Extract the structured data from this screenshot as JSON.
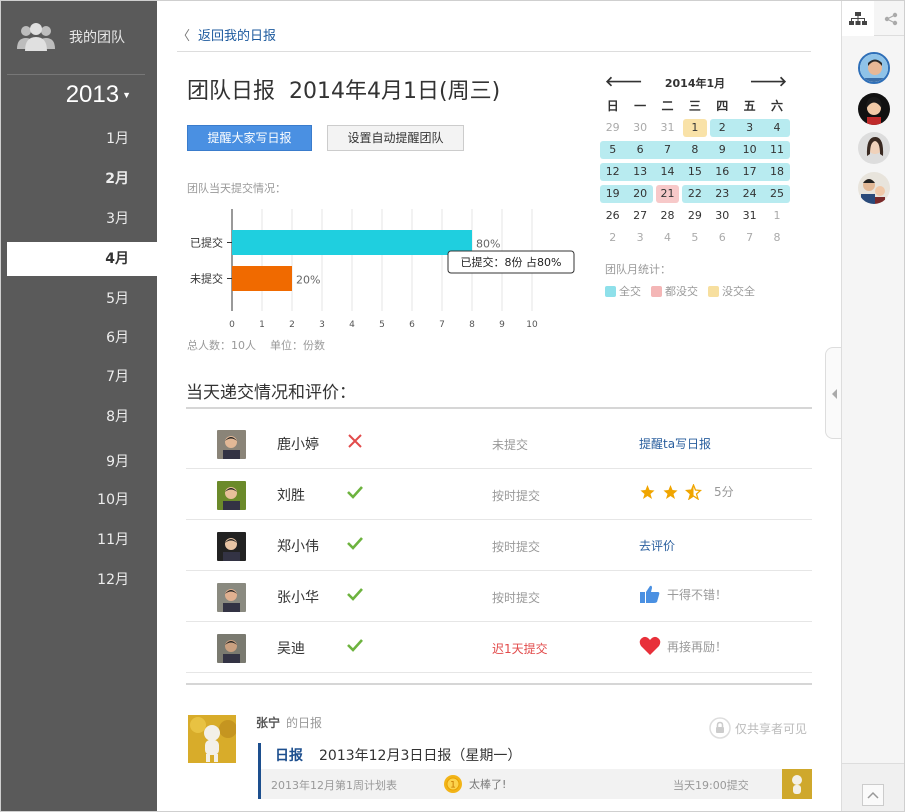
{
  "sidebar": {
    "team_label": "我的团队",
    "year": "2013",
    "months": [
      "1月",
      "2月",
      "3月",
      "4月",
      "5月",
      "6月",
      "7月",
      "8月",
      "9月",
      "10月",
      "11月",
      "12月"
    ],
    "active_month": "4月",
    "bold_months": [
      "2月",
      "4月"
    ]
  },
  "header": {
    "back_label": "返回我的日报",
    "title_prefix": "团队日报",
    "title_date": "2014年4月1日(周三)"
  },
  "buttons": {
    "remind_all": "提醒大家写日报",
    "auto_remind": "设置自动提醒团队"
  },
  "submission_chart": {
    "subtitle": "团队当天提交情况：",
    "tooltip": "已提交：8份 占80%",
    "footer_total": "总人数：10人",
    "footer_unit": "单位：份数"
  },
  "chart_data": {
    "type": "bar",
    "orientation": "horizontal",
    "categories": [
      "已提交",
      "未提交"
    ],
    "values": [
      8,
      2
    ],
    "data_labels": [
      "80%",
      "20%"
    ],
    "colors": [
      "#1fcfdf",
      "#f06a00"
    ],
    "xlim": [
      0,
      10
    ],
    "xticks": [
      0,
      1,
      2,
      3,
      4,
      5,
      6,
      7,
      8,
      9,
      10
    ],
    "grid": true
  },
  "section": {
    "title": "当天递交情况和评价："
  },
  "members": [
    {
      "name": "鹿小婷",
      "submitted": false,
      "status": "未提交",
      "status_color": "gray",
      "action": "提醒ta写日报",
      "action_type": "link"
    },
    {
      "name": "刘胜",
      "submitted": true,
      "status": "按时提交",
      "status_color": "gray",
      "action": "5分",
      "action_type": "stars",
      "stars": 2.5
    },
    {
      "name": "郑小伟",
      "submitted": true,
      "status": "按时提交",
      "status_color": "gray",
      "action": "去评价",
      "action_type": "link"
    },
    {
      "name": "张小华",
      "submitted": true,
      "status": "按时提交",
      "status_color": "gray",
      "action": "干得不错！",
      "action_type": "thumb"
    },
    {
      "name": "吴迪",
      "submitted": true,
      "status": "迟1天提交",
      "status_color": "red",
      "action": "再接再励！",
      "action_type": "heart"
    }
  ],
  "post": {
    "author": "张宁",
    "author_suffix": "的日报",
    "privacy": "仅共享者可见",
    "report_label": "日报",
    "report_title": "2013年12月3日日报（星期一）",
    "plan": "2013年12月第1周计划表",
    "badge_text": "太棒了!",
    "submit_time": "当天19:00提交"
  },
  "calendar": {
    "month_label": "2014年1月",
    "prev": "🡐",
    "next": "🡒",
    "weekdays": [
      "日",
      "一",
      "二",
      "三",
      "四",
      "五",
      "六"
    ],
    "weeks": [
      [
        {
          "d": "29",
          "o": 1
        },
        {
          "d": "30",
          "o": 1
        },
        {
          "d": "31",
          "o": 1
        },
        {
          "d": "1",
          "s": "y"
        },
        {
          "d": "2",
          "s": "c"
        },
        {
          "d": "3",
          "s": "c"
        },
        {
          "d": "4",
          "s": "c"
        }
      ],
      [
        {
          "d": "5",
          "s": "c"
        },
        {
          "d": "6",
          "s": "c"
        },
        {
          "d": "7",
          "s": "c"
        },
        {
          "d": "8",
          "s": "c"
        },
        {
          "d": "9",
          "s": "c"
        },
        {
          "d": "10",
          "s": "c"
        },
        {
          "d": "11",
          "s": "c"
        }
      ],
      [
        {
          "d": "12",
          "s": "c"
        },
        {
          "d": "13",
          "s": "c"
        },
        {
          "d": "14",
          "s": "c"
        },
        {
          "d": "15",
          "s": "c"
        },
        {
          "d": "16",
          "s": "c"
        },
        {
          "d": "17",
          "s": "c"
        },
        {
          "d": "18",
          "s": "c"
        }
      ],
      [
        {
          "d": "19",
          "s": "c"
        },
        {
          "d": "20",
          "s": "c"
        },
        {
          "d": "21",
          "s": "p"
        },
        {
          "d": "22",
          "s": "c"
        },
        {
          "d": "23",
          "s": "c"
        },
        {
          "d": "24",
          "s": "c"
        },
        {
          "d": "25",
          "s": "c"
        }
      ],
      [
        {
          "d": "26"
        },
        {
          "d": "27"
        },
        {
          "d": "28"
        },
        {
          "d": "29"
        },
        {
          "d": "30"
        },
        {
          "d": "31"
        },
        {
          "d": "1",
          "o": 1
        }
      ],
      [
        {
          "d": "2",
          "o": 1
        },
        {
          "d": "3",
          "o": 1
        },
        {
          "d": "4",
          "o": 1
        },
        {
          "d": "5",
          "o": 1
        },
        {
          "d": "6",
          "o": 1
        },
        {
          "d": "7",
          "o": 1
        },
        {
          "d": "8",
          "o": 1
        }
      ]
    ],
    "stat_title": "团队月统计：",
    "legend": [
      {
        "label": "全交",
        "color": "#8ee0ea"
      },
      {
        "label": "都没交",
        "color": "#f4b6b6"
      },
      {
        "label": "没交全",
        "color": "#f7df9f"
      }
    ]
  },
  "colors": {
    "sidebar_bg": "#5a5a5a",
    "primary_button": "#4a90e2",
    "link": "#2a5f9e",
    "check": "#6db33f",
    "cross": "#e24b4b"
  }
}
